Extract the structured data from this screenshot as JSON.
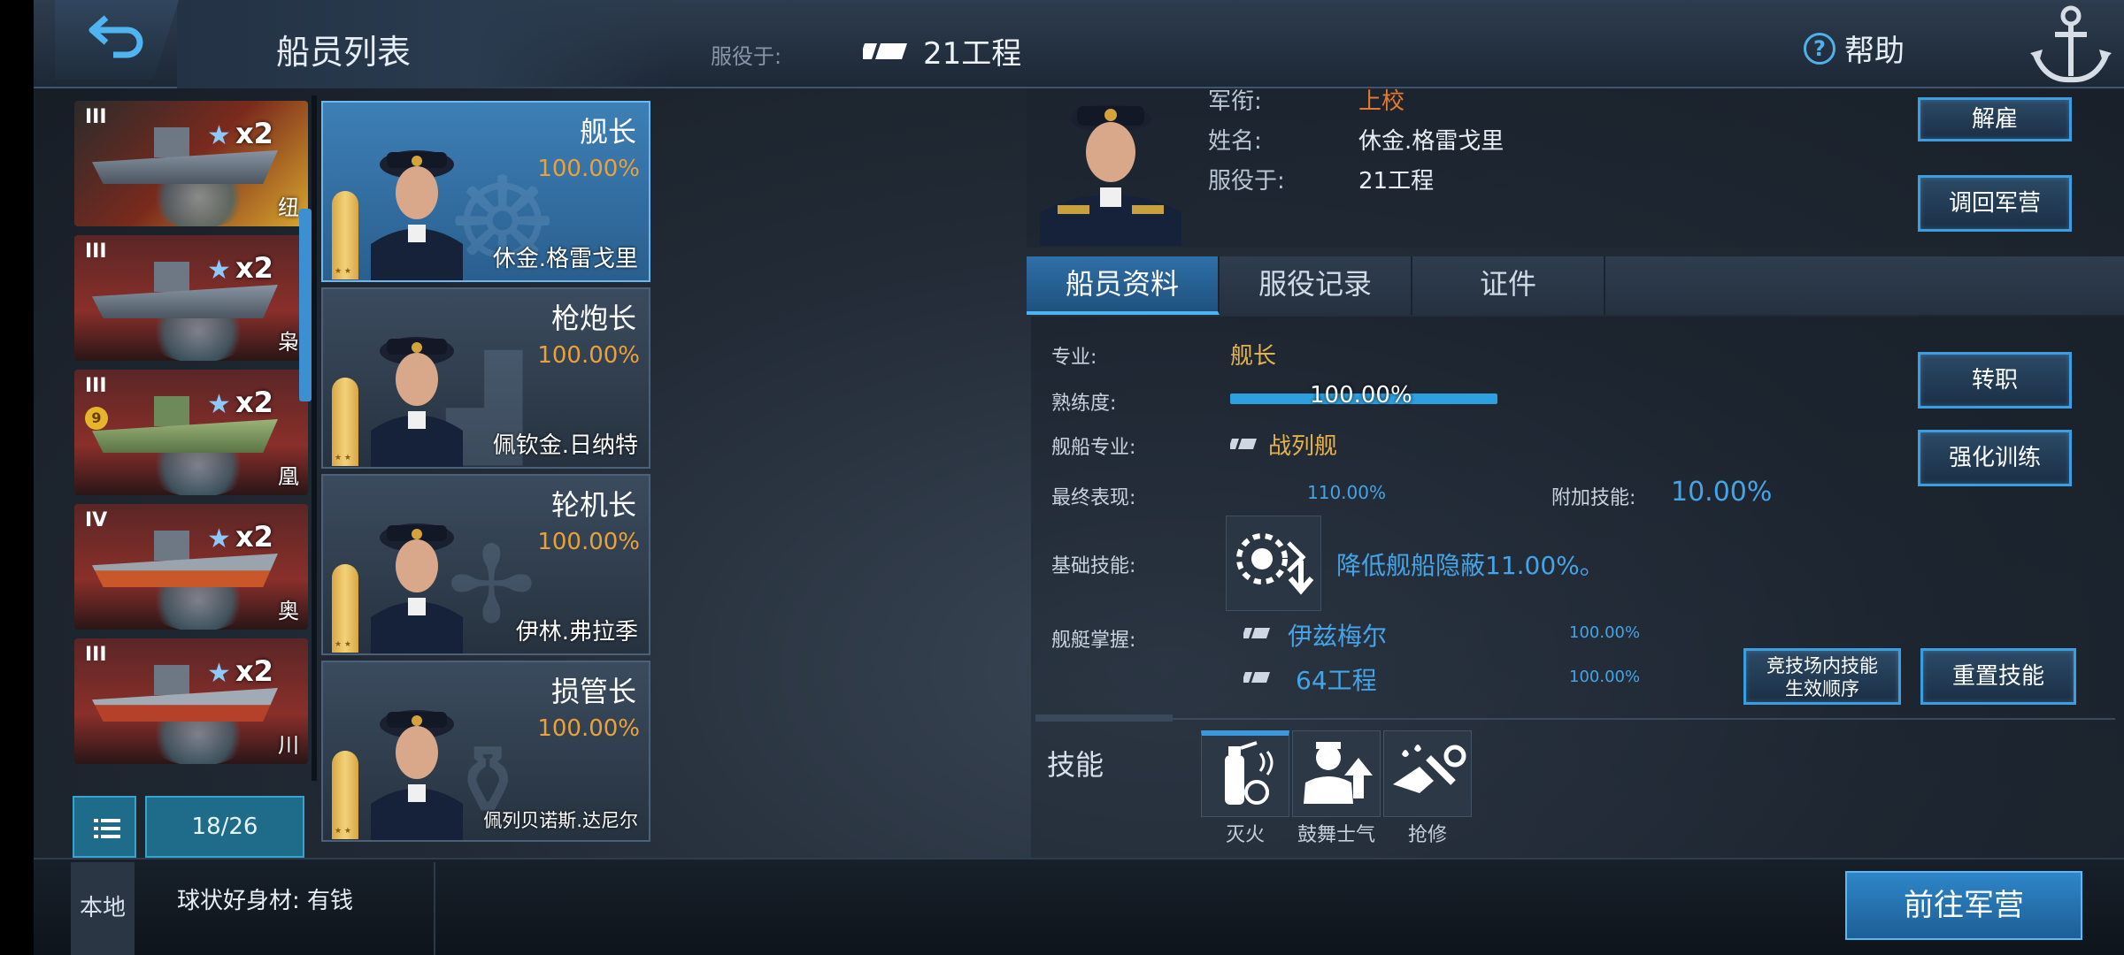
{
  "header": {
    "title": "船员列表",
    "serve_label": "服役于:",
    "serve_value": "21工程",
    "help_label": "帮助"
  },
  "ships": [
    {
      "tier": "III",
      "multiplier": "x2",
      "name": "纽"
    },
    {
      "tier": "III",
      "multiplier": "x2",
      "name": "枭"
    },
    {
      "tier": "III",
      "multiplier": "x2",
      "name": "凰",
      "badge": "9"
    },
    {
      "tier": "IV",
      "multiplier": "x2",
      "name": "奥"
    },
    {
      "tier": "III",
      "multiplier": "x2",
      "name": "川"
    }
  ],
  "ship_count": "18/26",
  "crew": [
    {
      "role": "舰长",
      "proficiency": "100.00%",
      "name": "休金.格雷戈里",
      "active": true
    },
    {
      "role": "枪炮长",
      "proficiency": "100.00%",
      "name": "佩钦金.日纳特"
    },
    {
      "role": "轮机长",
      "proficiency": "100.00%",
      "name": "伊林.弗拉季"
    },
    {
      "role": "损管长",
      "proficiency": "100.00%",
      "name": "佩列贝诺斯.达尼尔"
    }
  ],
  "officer": {
    "rank_label": "军衔:",
    "rank_value": "上校",
    "name_label": "姓名:",
    "name_value": "休金.格雷戈里",
    "serve_label": "服役于:",
    "serve_value": "21工程"
  },
  "buttons": {
    "dismiss": "解雇",
    "recall": "调回军营",
    "transfer": "转职",
    "train": "强化训练",
    "arena_order": "竞技场内技能生效顺序",
    "arena_line1": "竞技场内技能",
    "arena_line2": "生效顺序",
    "reset": "重置技能",
    "go_barracks": "前往军营"
  },
  "tabs": [
    {
      "label": "船员资料",
      "active": true
    },
    {
      "label": "服役记录"
    },
    {
      "label": "证件"
    }
  ],
  "profile": {
    "specialty_label": "专业:",
    "specialty_value": "舰长",
    "proficiency_label": "熟练度:",
    "proficiency_value": "100.00%",
    "proficiency_fraction": 1.0,
    "ship_spec_label": "舰船专业:",
    "ship_spec_value": "战列舰",
    "final_label": "最终表现:",
    "final_value": "110.00%",
    "extra_label": "附加技能:",
    "extra_value": "10.00%",
    "base_skill_label": "基础技能:",
    "base_skill_text": "降低舰船隐蔽11.00%。",
    "mastery_label": "舰艇掌握:",
    "mastery": [
      {
        "ship": "伊兹梅尔",
        "value": "100.00%"
      },
      {
        "ship": "64工程",
        "value": "100.00%"
      }
    ]
  },
  "skills": {
    "title": "技能",
    "items": [
      {
        "label": "灭火",
        "icon": "fire-extinguisher-icon"
      },
      {
        "label": "鼓舞士气",
        "icon": "morale-icon"
      },
      {
        "label": "抢修",
        "icon": "repair-icon"
      }
    ]
  },
  "chat": {
    "channel": "本地",
    "message": "球状好身材: 有钱"
  }
}
